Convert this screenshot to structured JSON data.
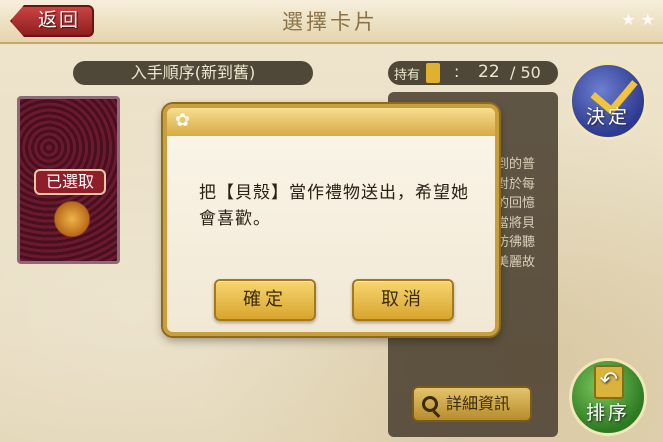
{
  "header": {
    "back_label": "返回",
    "title": "選擇卡片",
    "deco": "★ ★"
  },
  "sort": {
    "label": "入手順序(新到舊)"
  },
  "holdings": {
    "label": "持有",
    "colon": ":",
    "count": "22",
    "max": "/ 50"
  },
  "card": {
    "selected_label": "已選取"
  },
  "info_panel": {
    "text_lines": [
      "到的普",
      "對於每",
      "的回憶",
      "當將貝",
      "彷彿聽",
      "美麗故"
    ],
    "detail_button": "詳細資訊"
  },
  "side_buttons": {
    "confirm": "決定",
    "sort": "排序"
  },
  "dialog": {
    "message": "把【貝殼】當作禮物送出，希望她會喜歡。",
    "ok_label": "確定",
    "cancel_label": "取消"
  },
  "colors": {
    "dialog_border": "#c99e3c",
    "button_gold": "#d8a52e",
    "back_red": "#8e1f1f"
  }
}
